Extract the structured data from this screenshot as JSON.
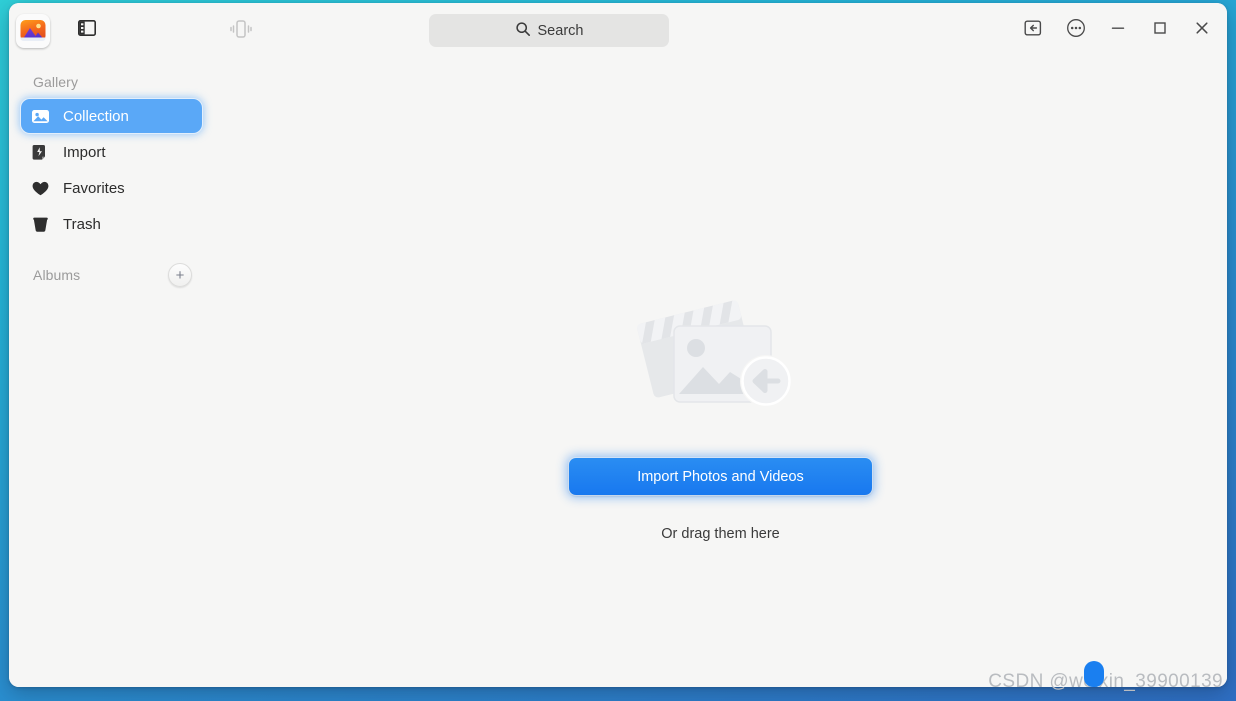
{
  "window": {
    "app_icon": "photos-app-icon",
    "background_accent": "#2a8fd0"
  },
  "headerbar": {
    "sidebar_toggle_icon": "sidebar-toggle-icon",
    "device_icon": "mobile-device-icon",
    "controls": [
      {
        "name": "restore-window-icon",
        "label": "↩"
      },
      {
        "name": "main-menu-icon",
        "label": "⋯"
      },
      {
        "name": "minimize-icon",
        "label": "—"
      },
      {
        "name": "maximize-icon",
        "label": "□"
      },
      {
        "name": "close-icon",
        "label": "✕"
      }
    ]
  },
  "search": {
    "icon": "search-icon",
    "placeholder": "Search",
    "value": "Search"
  },
  "sidebar": {
    "gallery_label": "Gallery",
    "items": [
      {
        "label": "Collection",
        "icon": "image-icon",
        "selected": true
      },
      {
        "label": "Import",
        "icon": "import-icon",
        "selected": false
      },
      {
        "label": "Favorites",
        "icon": "heart-icon",
        "selected": false
      },
      {
        "label": "Trash",
        "icon": "trash-icon",
        "selected": false
      }
    ],
    "albums_label": "Albums",
    "albums_add_label": "+"
  },
  "content": {
    "illustration": "photos-and-videos-import-illustration",
    "import_button_label": "Import Photos and Videos",
    "drag_hint": "Or drag them here"
  },
  "watermark": {
    "text": "CSDN @weixin_39900139"
  }
}
